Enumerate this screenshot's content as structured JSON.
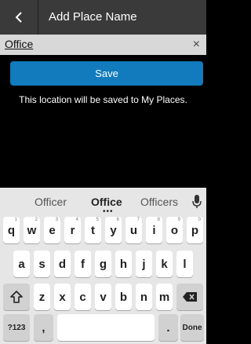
{
  "header": {
    "title": "Add Place Name",
    "back_icon": "back-chevron-icon"
  },
  "input": {
    "value": "Office",
    "clear_icon": "close-icon",
    "clear_glyph": "×"
  },
  "save_label": "Save",
  "note": "This location will be saved to My Places.",
  "keyboard": {
    "suggestions": [
      "Officer",
      "Office",
      "Officers"
    ],
    "more_indicator": "•••",
    "mic_icon": "microphone-icon",
    "row1": [
      {
        "k": "q",
        "h": "1"
      },
      {
        "k": "w",
        "h": "2"
      },
      {
        "k": "e",
        "h": "3"
      },
      {
        "k": "r",
        "h": "4"
      },
      {
        "k": "t",
        "h": "5"
      },
      {
        "k": "y",
        "h": "6"
      },
      {
        "k": "u",
        "h": "7"
      },
      {
        "k": "i",
        "h": "8"
      },
      {
        "k": "o",
        "h": "9"
      },
      {
        "k": "p",
        "h": "0"
      }
    ],
    "row2": [
      "a",
      "s",
      "d",
      "f",
      "g",
      "h",
      "j",
      "k",
      "l"
    ],
    "row3": [
      "z",
      "x",
      "c",
      "v",
      "b",
      "n",
      "m"
    ],
    "shift_icon": "shift-icon",
    "backspace_icon": "backspace-icon",
    "symbols_label": "?123",
    "comma_label": ",",
    "period_label": ".",
    "done_label": "Done",
    "colors": {
      "accent": "#117bbd"
    }
  }
}
